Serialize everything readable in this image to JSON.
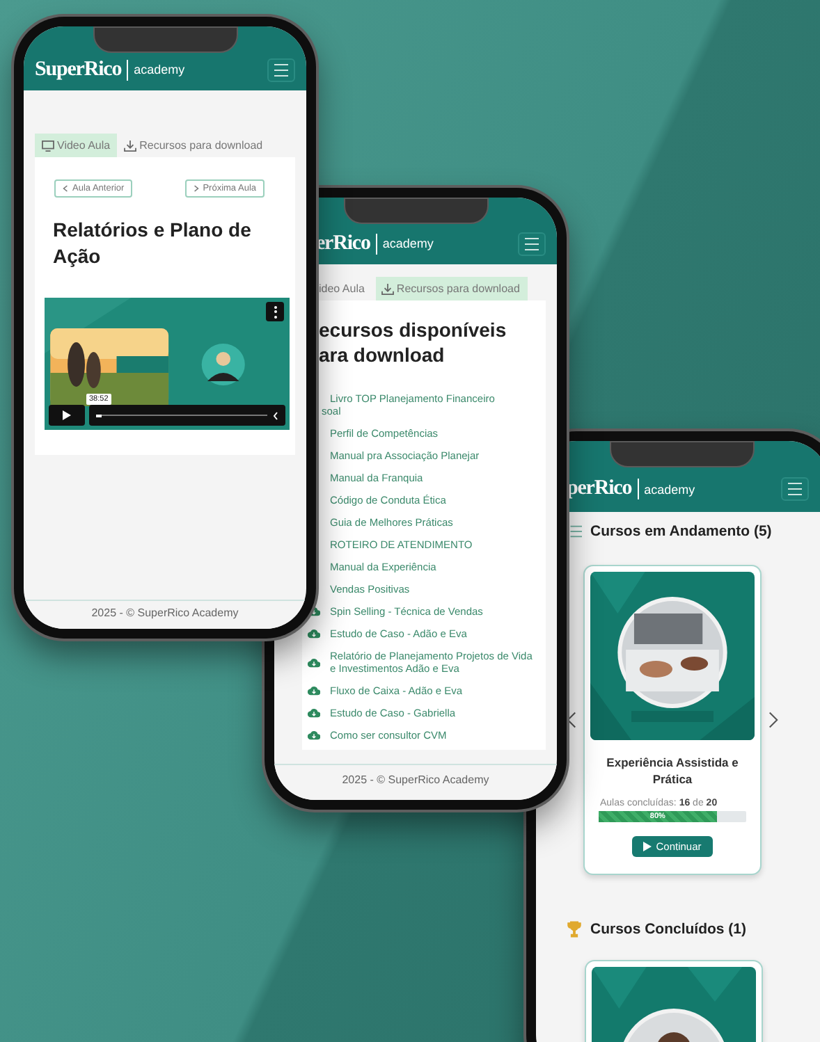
{
  "lesson_phone": {
    "logo": "SuperRico",
    "logo_sub": "academy",
    "tabs": [
      {
        "label": "Video Aula",
        "selected": true
      },
      {
        "label": "Recursos para download",
        "selected": false
      }
    ],
    "nav_buttons": [
      {
        "label": "Aula Anterior",
        "kind": "prev"
      },
      {
        "label": "Próxima Aula",
        "kind": "next"
      }
    ],
    "title": "Relatórios e Plano de Ação",
    "video": {
      "kind": "picture",
      "time": "38:52",
      "level": 0.03
    },
    "footer": "2025 - © SuperRico Academy"
  },
  "downloads_phone": {
    "logo": "erRico",
    "logo_sub": "academy",
    "tabs": [
      {
        "label": "ideo Aula",
        "selected": false
      },
      {
        "label": "Recursos para download",
        "selected": true
      }
    ],
    "title_lines": [
      "ecursos disponíveis",
      "ara download"
    ],
    "items": [
      {
        "text": "Livro TOP Planejamento Financeiro",
        "continuation": "soal",
        "icon": false
      },
      {
        "text": "Perfil de Competências",
        "icon": false
      },
      {
        "text": "Manual pra Associação Planejar",
        "icon": false
      },
      {
        "text": "Manual da Franquia",
        "icon": false
      },
      {
        "text": "Código de Conduta Ética",
        "icon": false
      },
      {
        "text": "Guia de Melhores Práticas",
        "icon": false
      },
      {
        "text": "ROTEIRO DE ATENDIMENTO",
        "icon": false
      },
      {
        "text": "Manual da Experiência",
        "icon": false
      },
      {
        "text": "Vendas Positivas",
        "icon": false
      },
      {
        "text": "Spin Selling - Técnica de Vendas",
        "icon": true
      },
      {
        "text": "Estudo de Caso - Adão e Eva",
        "icon": true
      },
      {
        "text": "Relatório de Planejamento Projetos de Vida e Investimentos Adão e Eva",
        "icon": true
      },
      {
        "text": "Fluxo de Caixa - Adão e Eva",
        "icon": true
      },
      {
        "text": "Estudo de Caso - Gabriella",
        "icon": true
      },
      {
        "text": "Como ser consultor CVM",
        "icon": true
      }
    ],
    "footer": "2025 - © SuperRico Academy"
  },
  "courses_phone": {
    "logo": "perRico",
    "logo_sub": "academy",
    "in_progress": {
      "heading": "Cursos em Andamento (5)",
      "card": {
        "title": "Experiência Assistida e Prática",
        "progress_text": "Aulas concluídas: **16** de **20**",
        "level": 0.8,
        "progress_label": "80%",
        "button": "Continuar"
      }
    },
    "completed": {
      "heading": "Cursos Concluídos (1)"
    }
  }
}
